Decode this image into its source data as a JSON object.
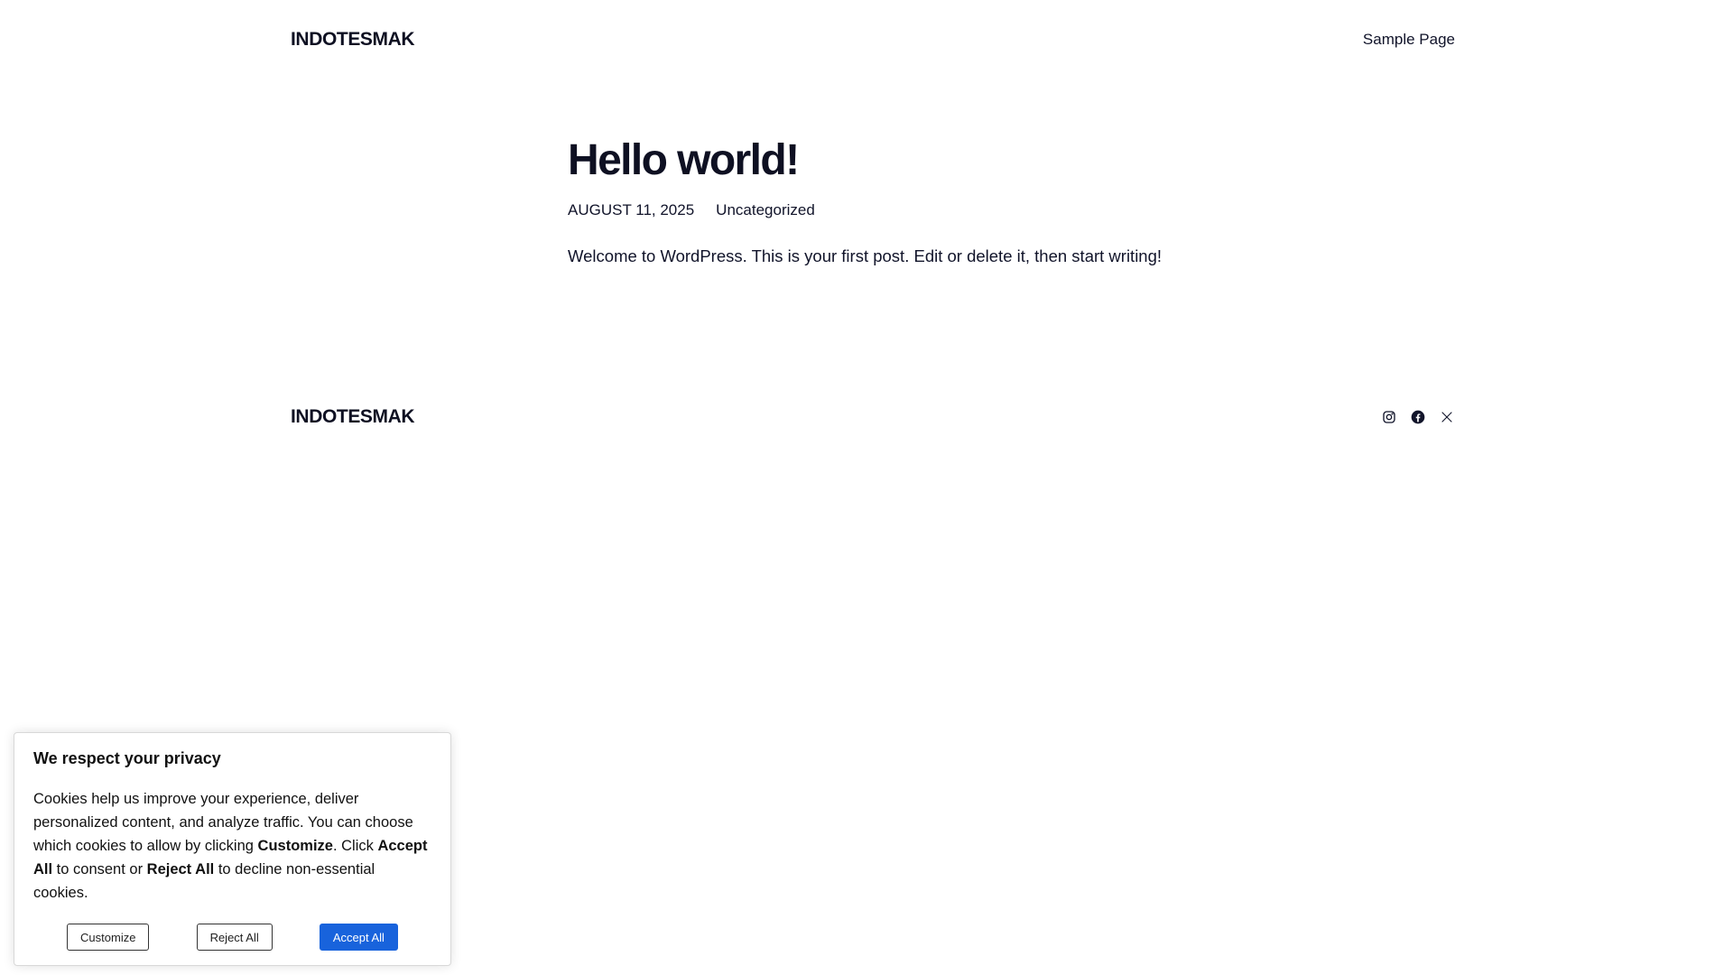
{
  "header": {
    "site_title": "INDOTESMAK",
    "nav": [
      {
        "label": "Sample Page"
      }
    ]
  },
  "post": {
    "title": "Hello world!",
    "date": "AUGUST 11, 2025",
    "category": "Uncategorized",
    "content": "Welcome to WordPress. This is your first post. Edit or delete it, then start writing!"
  },
  "footer": {
    "site_title": "INDOTESMAK",
    "social": [
      {
        "icon": "instagram-icon"
      },
      {
        "icon": "facebook-icon"
      },
      {
        "icon": "x-icon"
      }
    ]
  },
  "cookie_banner": {
    "title": "We respect your privacy",
    "text_1": "Cookies help us improve your experience, deliver personalized content, and analyze traffic. You can choose which cookies to allow by clicking ",
    "customize_word": "Customize",
    "text_2": ". Click ",
    "accept_word": "Accept All",
    "text_3": " to consent or ",
    "reject_word": "Reject All",
    "text_4": " to decline non-essential cookies.",
    "customize_label": "Customize",
    "reject_label": "Reject All",
    "accept_label": "Accept All",
    "accent_color": "#1863dc"
  }
}
